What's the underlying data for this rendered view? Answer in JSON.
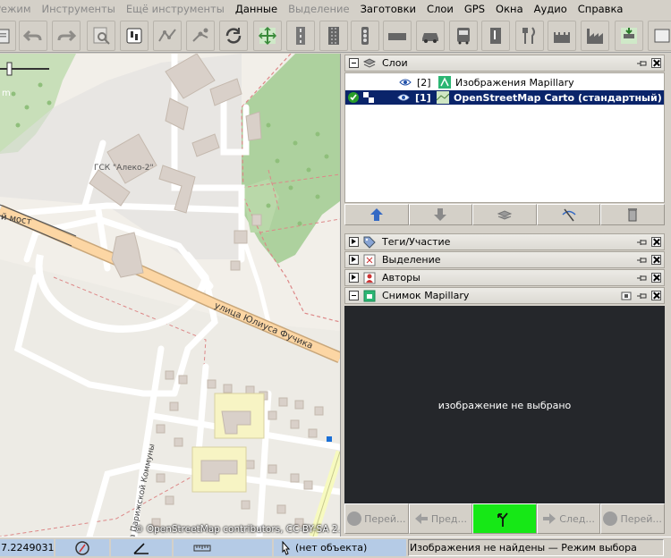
{
  "menu": {
    "items": [
      {
        "label": "Режим",
        "disabled": true
      },
      {
        "label": "Инструменты",
        "disabled": true
      },
      {
        "label": "Ещё инструменты",
        "disabled": true
      },
      {
        "label": "Данные",
        "disabled": false
      },
      {
        "label": "Выделение",
        "disabled": true
      },
      {
        "label": "Заготовки",
        "disabled": false
      },
      {
        "label": "Слои",
        "disabled": false
      },
      {
        "label": "GPS",
        "disabled": false
      },
      {
        "label": "Окна",
        "disabled": false
      },
      {
        "label": "Аудио",
        "disabled": false
      },
      {
        "label": "Справка",
        "disabled": false
      }
    ]
  },
  "toolbar": {
    "icons": [
      "open-file-icon",
      "undo-icon",
      "redo-icon",
      "zoom-to-data-icon",
      "preferences-icon",
      "gps-track-icon",
      "presets-icon",
      "refresh-icon",
      "zoom-to-layer-icon",
      "road-icon",
      "motorway-icon",
      "traffic-signals-icon",
      "barrier-icon",
      "car-icon",
      "bus-icon",
      "building-entrance-icon",
      "restaurant-icon",
      "castle-icon",
      "factory-icon",
      "download-along-icon",
      "more-tools-icon"
    ]
  },
  "map": {
    "labels": {
      "bridge": "й мост",
      "street": "улица Юлиуса Фучика",
      "garage": "ГСК \"Алеко-2\"",
      "commune": "а Парижской Коммуны",
      "scale_m": "m"
    },
    "attribution": "© OpenStreetMap contributors, CC-BY-SA 2.0"
  },
  "layers_panel": {
    "title": "Слои",
    "layers": [
      {
        "index": "[2]",
        "name": "Изображения Mapillary",
        "selected": false,
        "visible": true
      },
      {
        "index": "[1]",
        "name": "OpenStreetMap Carto (стандартный)",
        "selected": true,
        "visible": true
      }
    ],
    "buttons": [
      "move-up-icon",
      "move-down-icon",
      "merge-icon",
      "toggle-visibility-icon",
      "delete-icon"
    ]
  },
  "panels": {
    "tags": "Теги/Участие",
    "selection": "Выделение",
    "authors": "Авторы",
    "mapillary": "Снимок Mapillary"
  },
  "mapillary": {
    "no_image": "изображение не выбрано",
    "buttons": {
      "first": "Перей...",
      "prev": "Пред...",
      "next": "След...",
      "last": "Перей..."
    }
  },
  "status": {
    "coordinate": "7.2249031",
    "object": "(нет объекта)",
    "message": "Изображения не найдены — Режим выбора"
  },
  "colors": {
    "selected_row": "#0a246a",
    "mapillary_green": "#16e816",
    "status_blue": "#b5cbe6",
    "road_orange": "#fcd6a4",
    "park_green": "#add19e"
  }
}
